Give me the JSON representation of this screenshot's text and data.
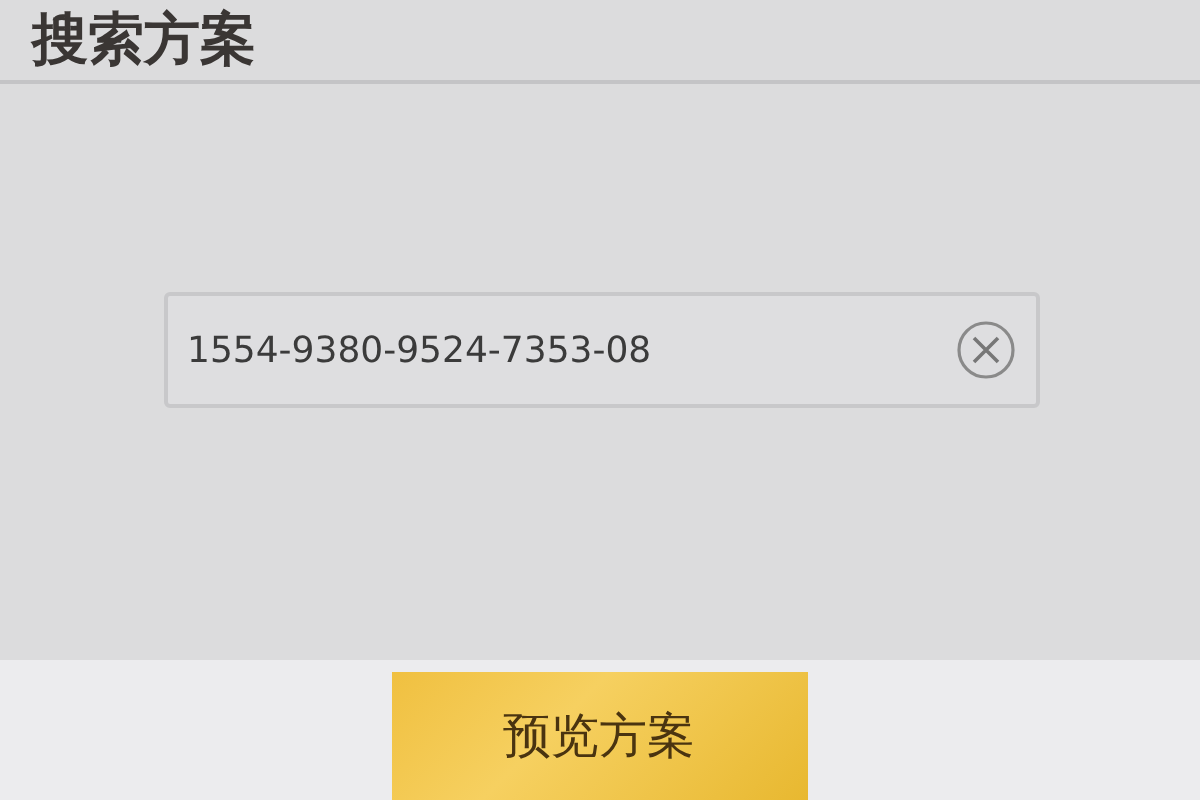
{
  "title": "搜索方案",
  "search": {
    "value": "1554-9380-9524-7353-08"
  },
  "button": {
    "label": "预览方案"
  }
}
